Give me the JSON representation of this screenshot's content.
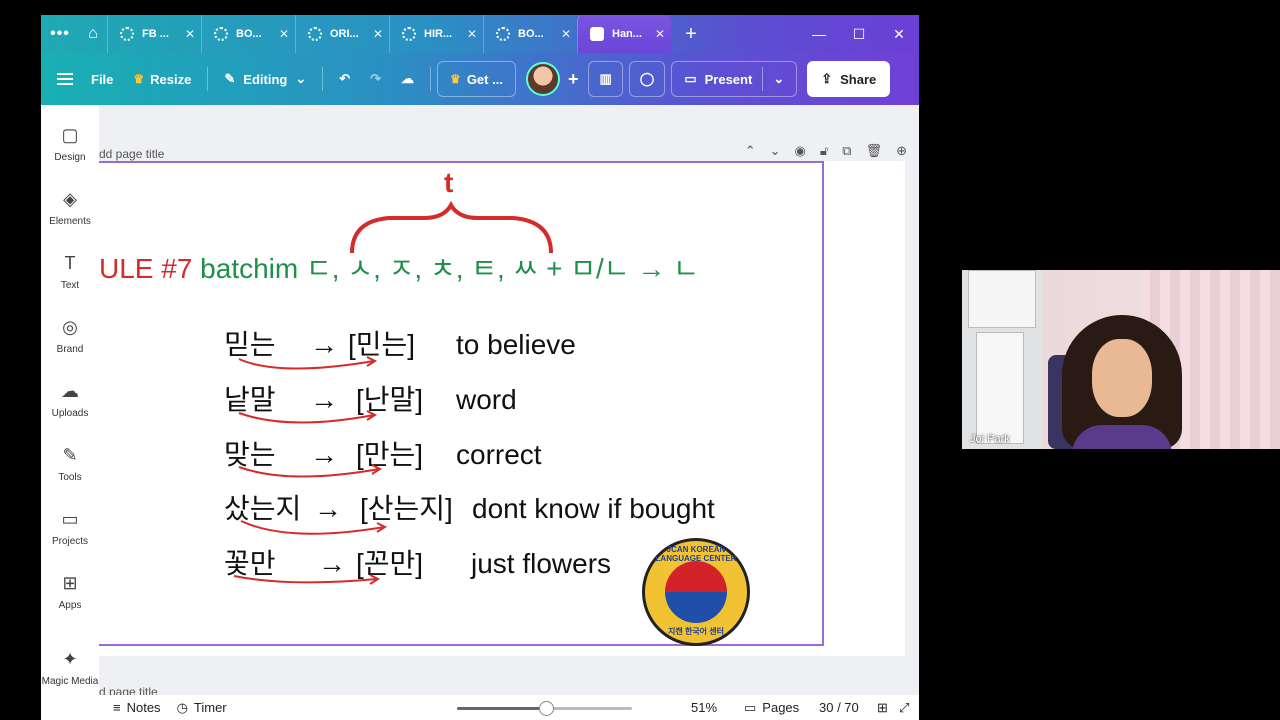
{
  "tabs": [
    {
      "label": "FB ..."
    },
    {
      "label": "BO..."
    },
    {
      "label": "ORI..."
    },
    {
      "label": "HIR..."
    },
    {
      "label": "BO..."
    },
    {
      "label": "Han..."
    }
  ],
  "toolbar": {
    "file": "File",
    "resize": "Resize",
    "editing": "Editing",
    "get": "Get ...",
    "present": "Present",
    "share": "Share"
  },
  "sidebar": [
    {
      "label": "Design",
      "icon": "design-icon"
    },
    {
      "label": "Elements",
      "icon": "elements-icon"
    },
    {
      "label": "Text",
      "icon": "text-icon"
    },
    {
      "label": "Brand",
      "icon": "brand-icon"
    },
    {
      "label": "Uploads",
      "icon": "uploads-icon"
    },
    {
      "label": "Tools",
      "icon": "tools-icon"
    },
    {
      "label": "Projects",
      "icon": "projects-icon"
    },
    {
      "label": "Apps",
      "icon": "apps-icon"
    },
    {
      "label": "Magic Media",
      "icon": "magic-media-icon"
    }
  ],
  "page": {
    "title_placeholder": "dd page title",
    "title_placeholder2": "d page title"
  },
  "slide": {
    "t_mark": "t",
    "rule_red": "ULE #7",
    "rule_green": " batchim ㄷ, ㅅ, ㅈ, ㅊ, ㅌ, ㅆ + ㅁ/ㄴ     → ㄴ",
    "rows": [
      {
        "word": "믿는",
        "arrow": "→",
        "pron": "[민는]",
        "meaning": "to believe"
      },
      {
        "word": "낱말",
        "arrow": "→",
        "pron": "[난말]",
        "meaning": "word"
      },
      {
        "word": "맞는",
        "arrow": "→",
        "pron": "[만는]",
        "meaning": "correct"
      },
      {
        "word": "샀는지",
        "arrow": "→",
        "pron": "[산는지]",
        "meaning": "dont know if bought"
      },
      {
        "word": "꽃만",
        "arrow": "→",
        "pron": "[꼰만]",
        "meaning": "just flowers"
      }
    ],
    "logo_top": "JCAN KOREAN LANGUAGE CENTER",
    "logo_bottom": "지캔 한국어 센터"
  },
  "status": {
    "notes": "Notes",
    "timer": "Timer",
    "zoom": "51%",
    "zoom_fraction": 0.51,
    "pages_label": "Pages",
    "page_count": "30 / 70"
  },
  "webcam": {
    "name": "Joi Park"
  }
}
